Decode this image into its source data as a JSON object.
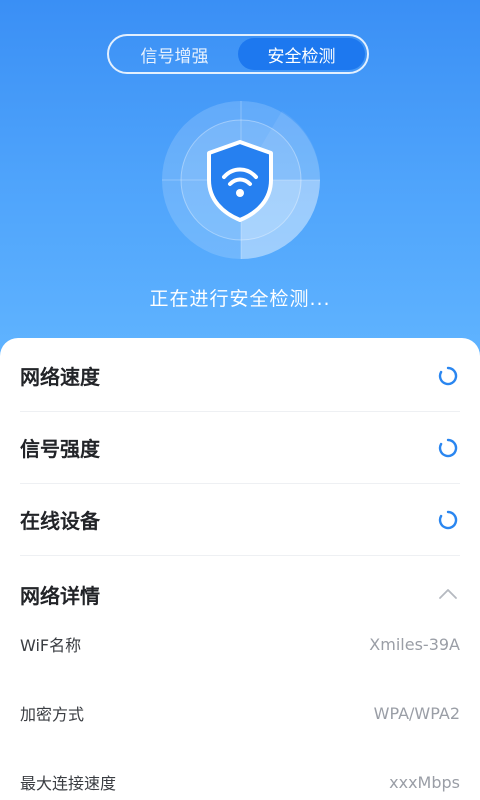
{
  "tabs": [
    {
      "label": "信号增强",
      "active": false
    },
    {
      "label": "安全检测",
      "active": true
    }
  ],
  "scanner": {
    "icon": "wifi-shield-icon",
    "status_text": "正在进行安全检测..."
  },
  "checks": [
    {
      "label": "网络速度",
      "state": "loading"
    },
    {
      "label": "信号强度",
      "state": "loading"
    },
    {
      "label": "在线设备",
      "state": "loading"
    }
  ],
  "network_details": {
    "title": "网络详情",
    "expanded": true,
    "items": [
      {
        "label": "WiF名称",
        "value": "Xmiles-39A"
      },
      {
        "label": "加密方式",
        "value": "WPA/WPA2"
      },
      {
        "label": "最大连接速度",
        "value": "xxxMbps"
      }
    ]
  },
  "colors": {
    "accent": "#1d78ef",
    "spinner": "#2a86f0",
    "background_top": "#3a8ff5",
    "background_bottom": "#62b6ff"
  }
}
